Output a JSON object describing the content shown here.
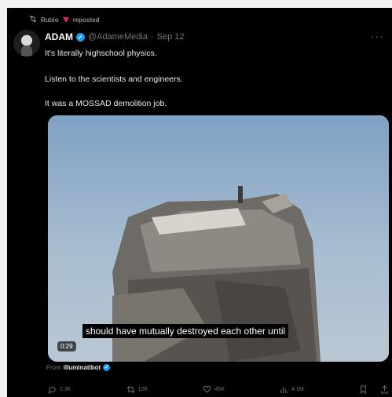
{
  "repost": {
    "user": "Rubio",
    "label": "reposted"
  },
  "tweet": {
    "name": "ADAM",
    "handle": "@AdameMedia",
    "date": "Sep 12",
    "lines": [
      "It's literally highschool physics.",
      "Listen to the scientists and engineers.",
      "It was a MOSSAD demolition job."
    ]
  },
  "media": {
    "subtitle": "should have mutually destroyed each other until",
    "time": "0:29"
  },
  "from": {
    "prefix": "From",
    "account": "illuminatibot"
  },
  "actions": {
    "replies": "1.3K",
    "reposts": "12K",
    "likes": "45K",
    "views": "4.1M"
  },
  "colors": {
    "verified": "#1d9bf0",
    "repost_arrow": "#e0245e"
  }
}
